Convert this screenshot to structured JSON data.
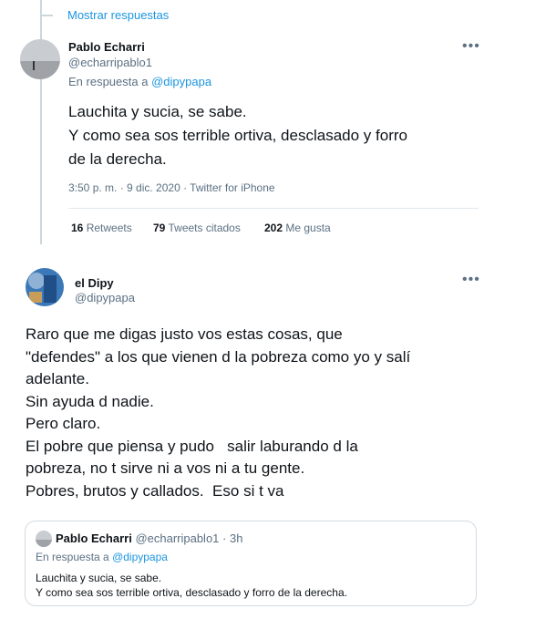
{
  "show_replies": "Mostrar respuestas",
  "tweet1": {
    "name": "Pablo Echarri",
    "handle": "@echarripablo1",
    "reply_prefix": "En respuesta a",
    "reply_to": "@dipypapa",
    "lines": [
      "Lauchita y sucia, se sabe.",
      "Y como sea sos terrible ortiva, desclasado y forro",
      "de la derecha."
    ],
    "meta": "3:50 p. m. · 9 dic. 2020 · Twitter for iPhone",
    "retweets_count": "16",
    "retweets_label": "Retweets",
    "quotes_count": "79",
    "quotes_label": "Tweets citados",
    "likes_count": "202",
    "likes_label": "Me gusta"
  },
  "tweet2": {
    "name": "el Dipy",
    "handle": "@dipypapa",
    "lines": [
      "Raro que me digas justo vos estas cosas, que",
      "\"defendes\" a los que vienen d la pobreza como yo y salí",
      "adelante.",
      "Sin ayuda d nadie.",
      "Pero claro.",
      "El pobre que piensa y pudo   salir laburando d la",
      "pobreza, no t sirve ni a vos ni a tu gente.",
      "Pobres, brutos y callados.  Eso si t va"
    ]
  },
  "quote": {
    "name": "Pablo Echarri",
    "handle_time": "@echarripablo1 · 3h",
    "reply_prefix": "En respuesta a",
    "reply_to": "@dipypapa",
    "lines": [
      "Lauchita y sucia, se sabe.",
      "Y como sea sos terrible ortiva, desclasado y forro de la derecha."
    ]
  },
  "more_icon": "•••",
  "colors": {
    "link": "#1b95e0",
    "muted": "#5b7083",
    "border": "#e1e8ed"
  }
}
